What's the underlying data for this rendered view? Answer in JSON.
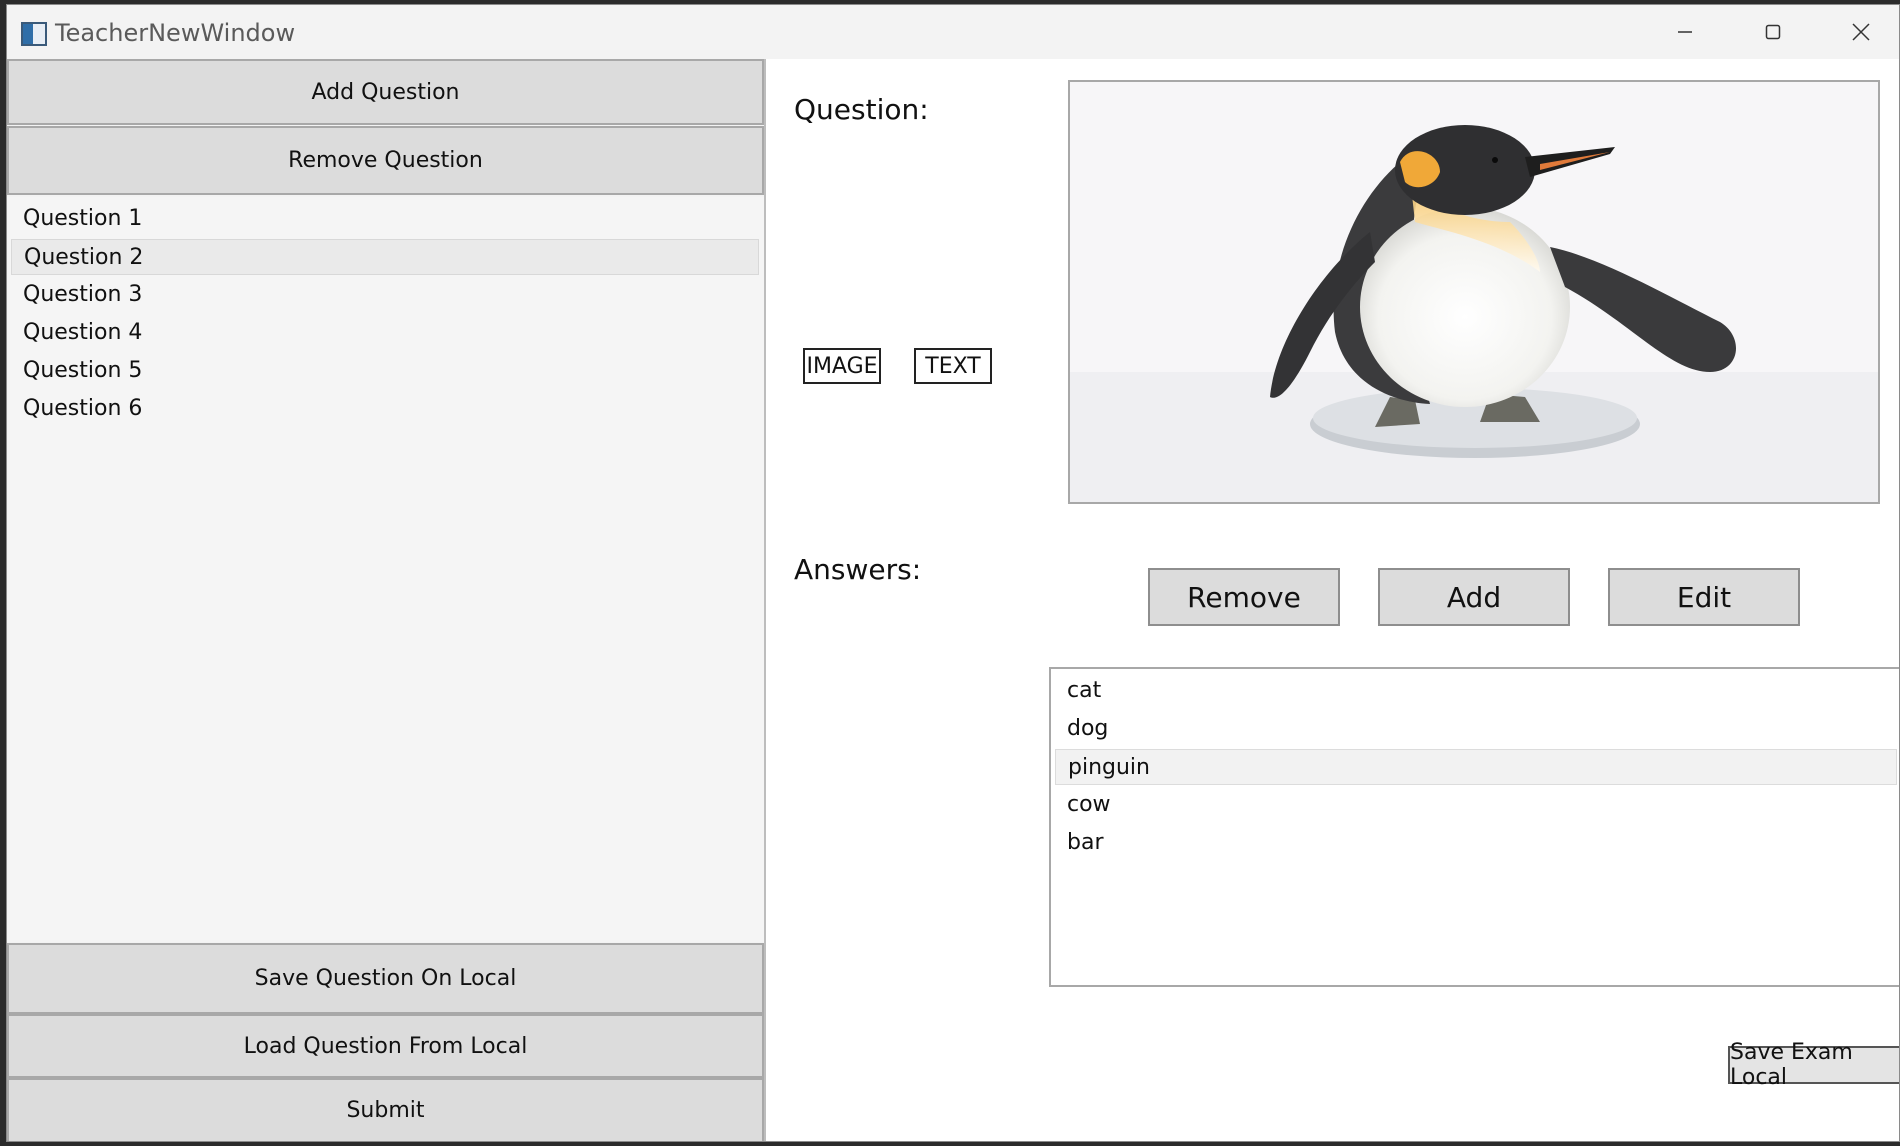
{
  "window": {
    "title": "TeacherNewWindow"
  },
  "left_panel": {
    "add_question": "Add Question",
    "remove_question": "Remove Question",
    "questions": [
      "Question 1",
      "Question 2",
      "Question 3",
      "Question 4",
      "Question 5",
      "Question 6"
    ],
    "selected_question": "Question 2",
    "save_local": "Save Question On Local",
    "load_local": "Load Question From Local",
    "submit": "Submit"
  },
  "question_area": {
    "label": "Question:",
    "image_button": "IMAGE",
    "text_button": "TEXT",
    "image_subject": "penguin-figurine"
  },
  "answers_area": {
    "label": "Answers:",
    "remove": "Remove",
    "add": "Add",
    "edit": "Edit",
    "answers": [
      "cat",
      "dog",
      "pinguin",
      "cow",
      "bar"
    ],
    "selected_answer": "pinguin"
  },
  "save_exam": "Save Exam Local",
  "icons": {
    "minimize": "minimize-icon",
    "maximize": "maximize-icon",
    "close": "close-icon",
    "app": "app-icon"
  }
}
